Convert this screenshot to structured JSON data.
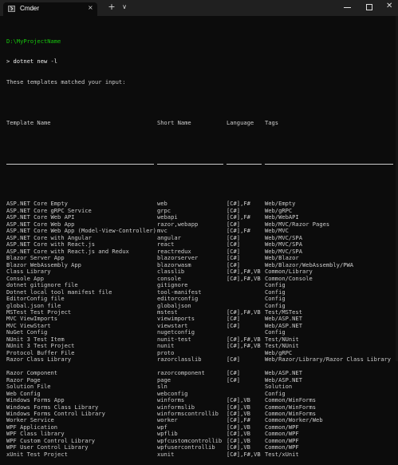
{
  "window": {
    "tab_title": "Cmder",
    "tab_close": "×",
    "new_tab": "+",
    "dropdown": "∨",
    "close": "✕"
  },
  "console": {
    "path": "D:\\MyProjectName",
    "command": "> dotnet new -l",
    "message": "These templates matched your input:",
    "headers": [
      "Template Name",
      "Short Name",
      "Language",
      "Tags"
    ],
    "rows": [
      [
        "ASP.NET Core Empty",
        "web",
        "[C#],F#",
        "Web/Empty"
      ],
      [
        "ASP.NET Core gRPC Service",
        "grpc",
        "[C#]",
        "Web/gRPC"
      ],
      [
        "ASP.NET Core Web API",
        "webapi",
        "[C#],F#",
        "Web/WebAPI"
      ],
      [
        "ASP.NET Core Web App",
        "razor,webapp",
        "[C#]",
        "Web/MVC/Razor Pages"
      ],
      [
        "ASP.NET Core Web App (Model-View-Controller)",
        "mvc",
        "[C#],F#",
        "Web/MVC"
      ],
      [
        "ASP.NET Core with Angular",
        "angular",
        "[C#]",
        "Web/MVC/SPA"
      ],
      [
        "ASP.NET Core with React.js",
        "react",
        "[C#]",
        "Web/MVC/SPA"
      ],
      [
        "ASP.NET Core with React.js and Redux",
        "reactredux",
        "[C#]",
        "Web/MVC/SPA"
      ],
      [
        "Blazor Server App",
        "blazorserver",
        "[C#]",
        "Web/Blazor"
      ],
      [
        "Blazor WebAssembly App",
        "blazorwasm",
        "[C#]",
        "Web/Blazor/WebAssembly/PWA"
      ],
      [
        "Class Library",
        "classlib",
        "[C#],F#,VB",
        "Common/Library"
      ],
      [
        "Console App",
        "console",
        "[C#],F#,VB",
        "Common/Console"
      ],
      [
        "dotnet gitignore file",
        "gitignore",
        "",
        "Config"
      ],
      [
        "Dotnet local tool manifest file",
        "tool-manifest",
        "",
        "Config"
      ],
      [
        "EditorConfig file",
        "editorconfig",
        "",
        "Config"
      ],
      [
        "global.json file",
        "globaljson",
        "",
        "Config"
      ],
      [
        "MSTest Test Project",
        "mstest",
        "[C#],F#,VB",
        "Test/MSTest"
      ],
      [
        "MVC ViewImports",
        "viewimports",
        "[C#]",
        "Web/ASP.NET"
      ],
      [
        "MVC ViewStart",
        "viewstart",
        "[C#]",
        "Web/ASP.NET"
      ],
      [
        "NuGet Config",
        "nugetconfig",
        "",
        "Config"
      ],
      [
        "NUnit 3 Test Item",
        "nunit-test",
        "[C#],F#,VB",
        "Test/NUnit"
      ],
      [
        "NUnit 3 Test Project",
        "nunit",
        "[C#],F#,VB",
        "Test/NUnit"
      ],
      [
        "Protocol Buffer File",
        "proto",
        "",
        "Web/gRPC"
      ],
      [
        "Razor Class Library",
        "razorclasslib",
        "[C#]",
        "Web/Razor/Library/Razor Class Library"
      ],
      [
        "",
        "",
        "",
        ""
      ],
      [
        "Razor Component",
        "razorcomponent",
        "[C#]",
        "Web/ASP.NET"
      ],
      [
        "Razor Page",
        "page",
        "[C#]",
        "Web/ASP.NET"
      ],
      [
        "Solution File",
        "sln",
        "",
        "Solution"
      ],
      [
        "Web Config",
        "webconfig",
        "",
        "Config"
      ],
      [
        "Windows Forms App",
        "winforms",
        "[C#],VB",
        "Common/WinForms"
      ],
      [
        "Windows Forms Class Library",
        "winformslib",
        "[C#],VB",
        "Common/WinForms"
      ],
      [
        "Windows Forms Control Library",
        "winformscontrollib",
        "[C#],VB",
        "Common/WinForms"
      ],
      [
        "Worker Service",
        "worker",
        "[C#],F#",
        "Common/Worker/Web"
      ],
      [
        "WPF Application",
        "wpf",
        "[C#],VB",
        "Common/WPF"
      ],
      [
        "WPF Class library",
        "wpflib",
        "[C#],VB",
        "Common/WPF"
      ],
      [
        "WPF Custom Control Library",
        "wpfcustomcontrollib",
        "[C#],VB",
        "Common/WPF"
      ],
      [
        "WPF User Control Library",
        "wpfusercontrollib",
        "[C#],VB",
        "Common/WPF"
      ],
      [
        "xUnit Test Project",
        "xunit",
        "[C#],F#,VB",
        "Test/xUnit"
      ]
    ]
  }
}
